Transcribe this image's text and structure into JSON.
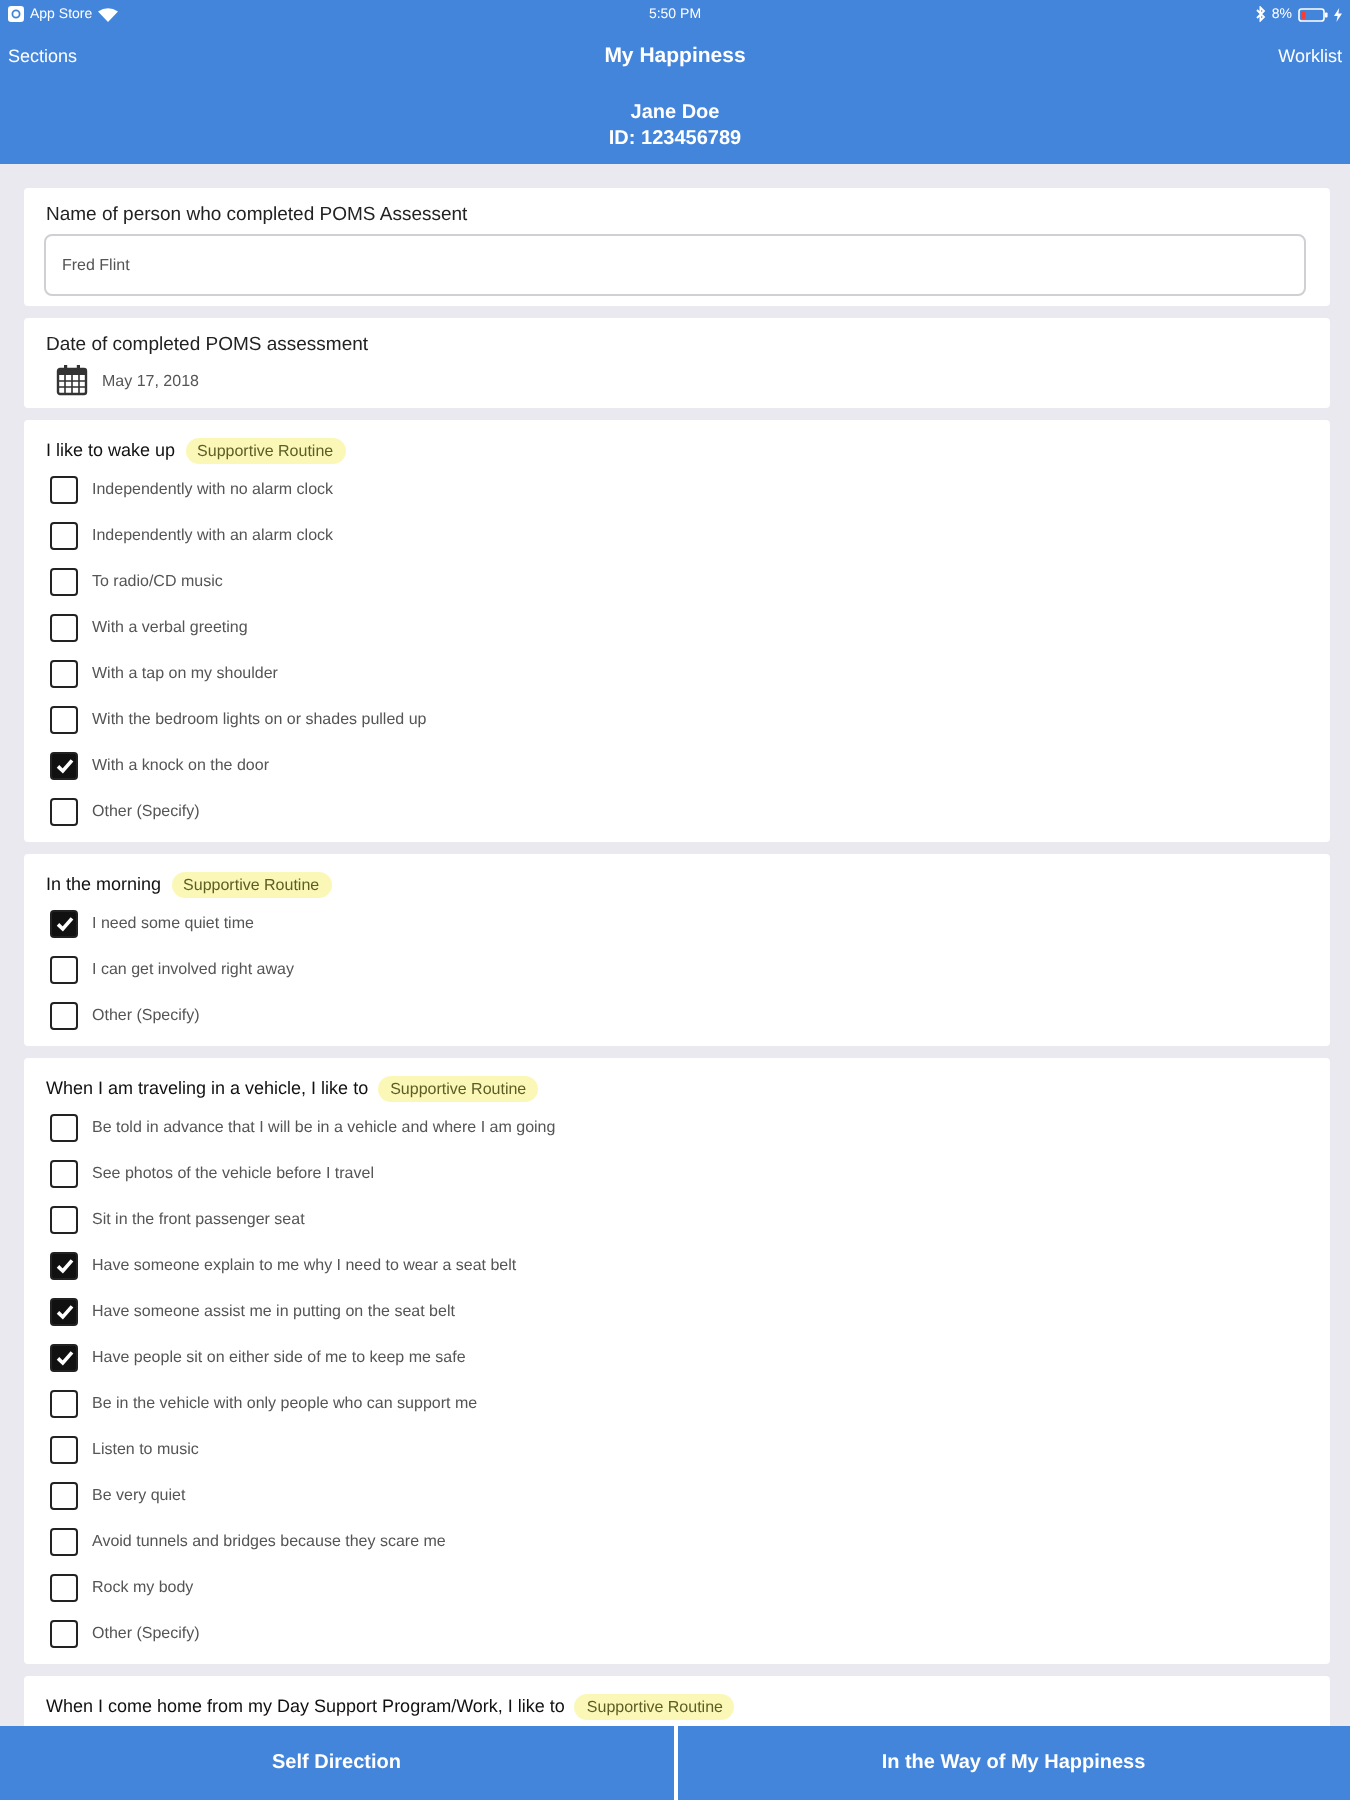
{
  "status_bar": {
    "carrier": "App Store",
    "time": "5:50 PM",
    "battery": "8%"
  },
  "nav": {
    "left": "Sections",
    "title": "My Happiness",
    "right": "Worklist"
  },
  "client": {
    "name": "Jane Doe",
    "id": "ID: 123456789"
  },
  "sections": [
    {
      "kind": "text",
      "label": "Name of person who completed POMS Assessent",
      "value": "Fred Flint"
    },
    {
      "kind": "date",
      "label": "Date of completed POMS assessment",
      "value": "May 17, 2018"
    },
    {
      "kind": "checklist",
      "question": "I like to wake up",
      "badge": "Supportive Routine",
      "options": [
        {
          "label": "Independently with no alarm clock",
          "checked": false
        },
        {
          "label": "Independently with an alarm clock",
          "checked": false
        },
        {
          "label": "To radio/CD music",
          "checked": false
        },
        {
          "label": "With a verbal greeting",
          "checked": false
        },
        {
          "label": "With a tap on my shoulder",
          "checked": false
        },
        {
          "label": "With the bedroom lights on or shades pulled up",
          "checked": false
        },
        {
          "label": "With a knock on the door",
          "checked": true
        },
        {
          "label": "Other (Specify)",
          "checked": false
        }
      ]
    },
    {
      "kind": "checklist",
      "question": "In the morning",
      "badge": "Supportive Routine",
      "options": [
        {
          "label": "I need some quiet time",
          "checked": true
        },
        {
          "label": "I can get involved right away",
          "checked": false
        },
        {
          "label": "Other (Specify)",
          "checked": false
        }
      ]
    },
    {
      "kind": "checklist",
      "question": "When I am traveling in a vehicle, I like to",
      "badge": "Supportive Routine",
      "options": [
        {
          "label": "Be told in advance that I will be in a vehicle and where I am going",
          "checked": false
        },
        {
          "label": "See photos of the vehicle before I travel",
          "checked": false
        },
        {
          "label": "Sit in the front passenger seat",
          "checked": false
        },
        {
          "label": "Have someone explain to me why I need to wear a seat belt",
          "checked": true
        },
        {
          "label": "Have someone assist me in putting on the seat belt",
          "checked": true
        },
        {
          "label": "Have people sit on either side of me to keep me safe",
          "checked": true
        },
        {
          "label": "Be in the vehicle with only people who can support me",
          "checked": false
        },
        {
          "label": "Listen to music",
          "checked": false
        },
        {
          "label": "Be very quiet",
          "checked": false
        },
        {
          "label": "Avoid tunnels and bridges because they scare me",
          "checked": false
        },
        {
          "label": "Rock my body",
          "checked": false
        },
        {
          "label": "Other (Specify)",
          "checked": false
        }
      ]
    },
    {
      "kind": "checklist",
      "question": "When I come home from my Day Support Program/Work, I like to",
      "badge": "Supportive Routine"
    }
  ],
  "footer_tabs": [
    {
      "label": "Self Direction"
    },
    {
      "label": "In the Way of My Happiness"
    }
  ]
}
